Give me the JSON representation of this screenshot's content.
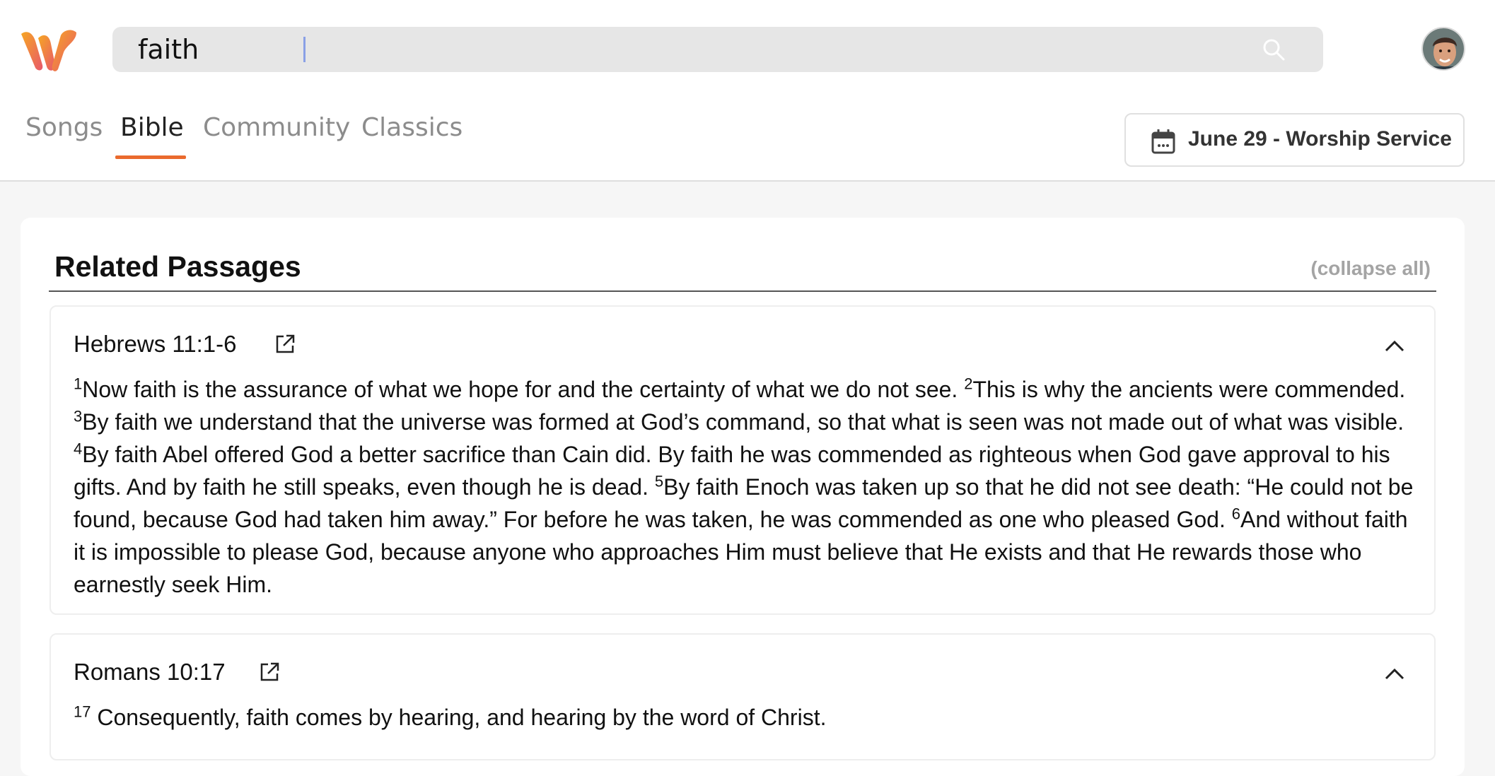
{
  "app": {
    "logo": "w-logo",
    "avatar": "user-avatar"
  },
  "search": {
    "value": "faith",
    "icon": "search-icon"
  },
  "tabs": [
    {
      "label": "Songs",
      "active": false
    },
    {
      "label": "Bible",
      "active": true
    },
    {
      "label": "Community",
      "active": false
    },
    {
      "label": "Classics",
      "active": false
    }
  ],
  "event": {
    "label": "June 29 - Worship Service",
    "icon": "calendar-icon"
  },
  "section": {
    "title": "Related Passages",
    "collapse_all": "(collapse all)"
  },
  "passages": [
    {
      "reference": "Hebrews 11:1-6",
      "verses": [
        {
          "num": "1",
          "text": "Now faith is the assurance of what we hope for and the certainty of what we do not see. "
        },
        {
          "num": "2",
          "text": "This is why the ancients were commended. "
        },
        {
          "num": "3",
          "text": "By faith we understand that the universe was formed at God’s command, so that what is seen was not made out of what was visible. "
        },
        {
          "num": "4",
          "text": "By faith Abel offered God a better sacrifice than Cain did. By faith he was commended as righteous when God gave approval to his gifts. And by faith he still speaks, even though he is dead. "
        },
        {
          "num": "5",
          "text": "By faith Enoch was taken up so that he did not see death: “He could not be found, because God had taken him away.” For before he was taken, he was commended as one who pleased God. "
        },
        {
          "num": "6",
          "text": "And without faith it is impossible to please God, because anyone who approaches Him must believe that He exists and that He rewards those who earnestly seek Him."
        }
      ]
    },
    {
      "reference": "Romans 10:17",
      "verses": [
        {
          "num": "17",
          "text": " Consequently, faith comes by hearing, and hearing by the word of Christ."
        }
      ]
    }
  ],
  "colors": {
    "accent": "#ea6a2d",
    "logo_gradient_start": "#f29a2e",
    "logo_gradient_end": "#e8586b"
  }
}
